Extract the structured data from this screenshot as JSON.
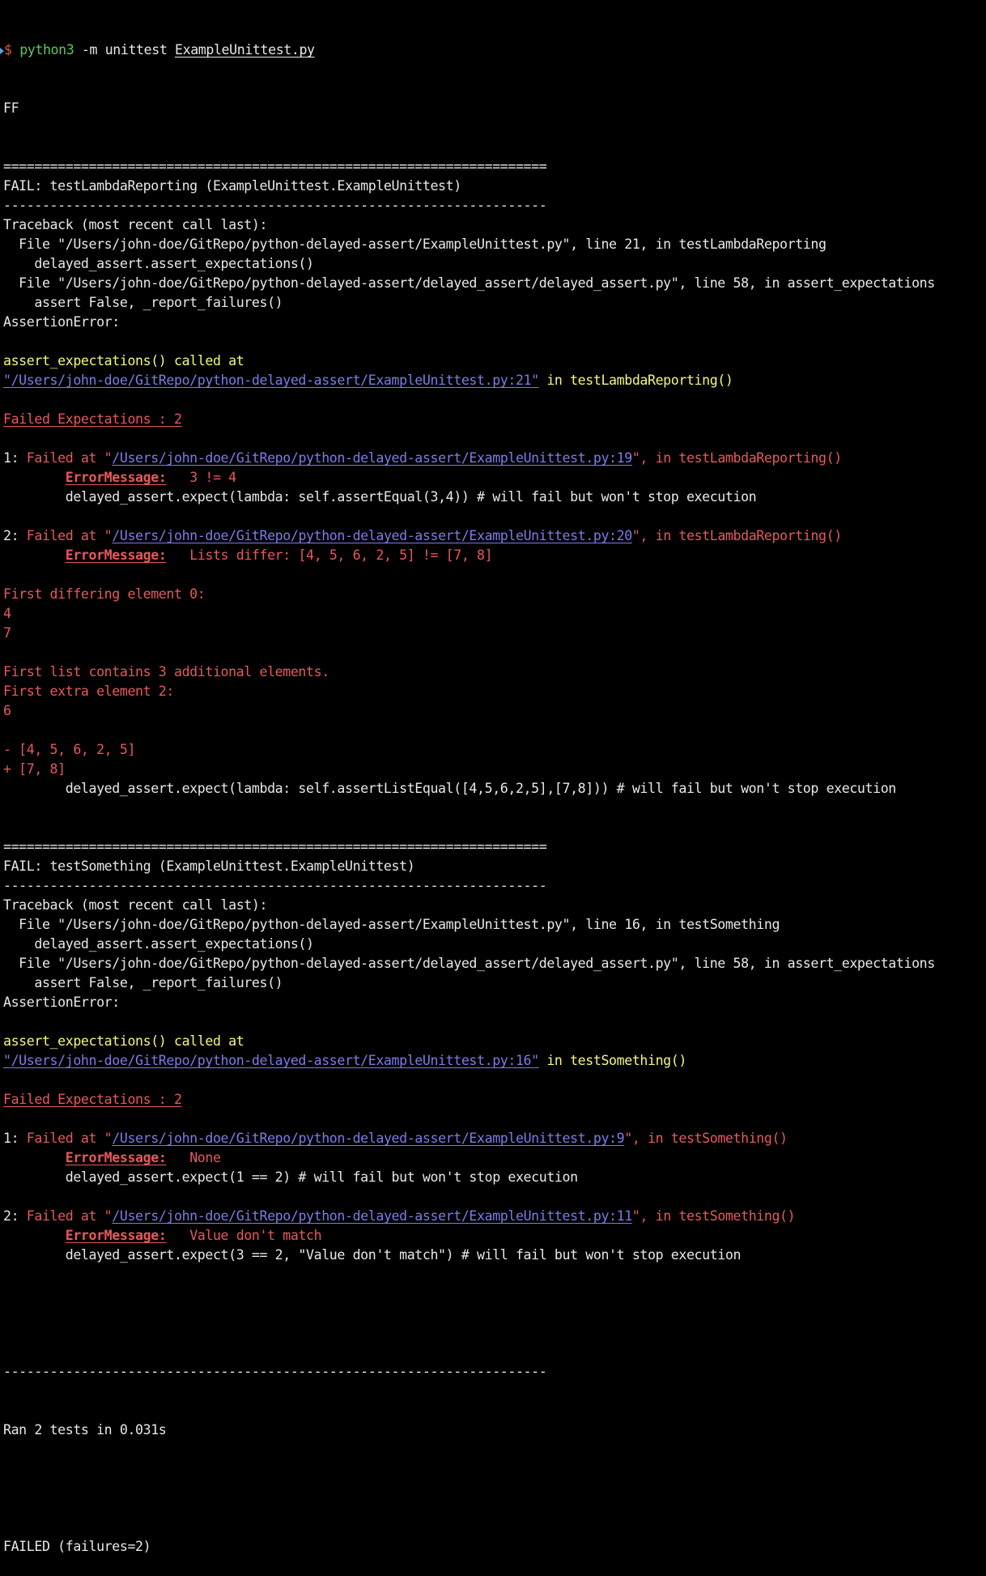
{
  "terminal": {
    "prompt_symbol": "$",
    "command_program": "python3",
    "command_args": " -m unittest ",
    "command_file": "ExampleUnittest.py",
    "progress": "FF",
    "separator_eq": "======================================================================",
    "separator_dash": "----------------------------------------------------------------------",
    "failures": [
      {
        "header": "FAIL: testLambdaReporting (ExampleUnittest.ExampleUnittest)",
        "traceback_title": "Traceback (most recent call last):",
        "frames": [
          {
            "file_line": "  File \"/Users/john-doe/GitRepo/python-delayed-assert/ExampleUnittest.py\", line 21, in testLambdaReporting",
            "code": "    delayed_assert.assert_expectations()"
          },
          {
            "file_line": "  File \"/Users/john-doe/GitRepo/python-delayed-assert/delayed_assert/delayed_assert.py\", line 58, in assert_expectations",
            "code": "    assert False, _report_failures()"
          }
        ],
        "error": "AssertionError:",
        "called_at": "assert_expectations() called at",
        "called_path": "\"/Users/john-doe/GitRepo/python-delayed-assert/ExampleUnittest.py:21\"",
        "called_in": " in testLambdaReporting()",
        "failed_count": "Failed Expectations : 2",
        "expectations": [
          {
            "prefix": "1: ",
            "failed_at": "Failed at \"",
            "path": "/Users/john-doe/GitRepo/python-delayed-assert/ExampleUnittest.py:19",
            "suffix": "\", in testLambdaReporting()",
            "error_label": "ErrorMessage:",
            "error_message": "   3 != 4",
            "extra_lines": [],
            "code": "        delayed_assert.expect(lambda: self.assertEqual(3,4)) # will fail but won't stop execution"
          },
          {
            "prefix": "2: ",
            "failed_at": "Failed at \"",
            "path": "/Users/john-doe/GitRepo/python-delayed-assert/ExampleUnittest.py:20",
            "suffix": "\", in testLambdaReporting()",
            "error_label": "ErrorMessage:",
            "error_message": "   Lists differ: [4, 5, 6, 2, 5] != [7, 8]",
            "extra_lines": [
              "",
              "First differing element 0:",
              "4",
              "7",
              "",
              "First list contains 3 additional elements.",
              "First extra element 2:",
              "6",
              "",
              "- [4, 5, 6, 2, 5]",
              "+ [7, 8]"
            ],
            "code": "        delayed_assert.expect(lambda: self.assertListEqual([4,5,6,2,5],[7,8])) # will fail but won't stop execution"
          }
        ]
      },
      {
        "header": "FAIL: testSomething (ExampleUnittest.ExampleUnittest)",
        "traceback_title": "Traceback (most recent call last):",
        "frames": [
          {
            "file_line": "  File \"/Users/john-doe/GitRepo/python-delayed-assert/ExampleUnittest.py\", line 16, in testSomething",
            "code": "    delayed_assert.assert_expectations()"
          },
          {
            "file_line": "  File \"/Users/john-doe/GitRepo/python-delayed-assert/delayed_assert/delayed_assert.py\", line 58, in assert_expectations",
            "code": "    assert False, _report_failures()"
          }
        ],
        "error": "AssertionError:",
        "called_at": "assert_expectations() called at",
        "called_path": "\"/Users/john-doe/GitRepo/python-delayed-assert/ExampleUnittest.py:16\"",
        "called_in": " in testSomething()",
        "failed_count": "Failed Expectations : 2",
        "expectations": [
          {
            "prefix": "1: ",
            "failed_at": "Failed at \"",
            "path": "/Users/john-doe/GitRepo/python-delayed-assert/ExampleUnittest.py:9",
            "suffix": "\", in testSomething()",
            "error_label": "ErrorMessage:",
            "error_message": "   None",
            "extra_lines": [],
            "code": "        delayed_assert.expect(1 == 2) # will fail but won't stop execution"
          },
          {
            "prefix": "2: ",
            "failed_at": "Failed at \"",
            "path": "/Users/john-doe/GitRepo/python-delayed-assert/ExampleUnittest.py:11",
            "suffix": "\", in testSomething()",
            "error_label": "ErrorMessage:",
            "error_message": "   Value don't match",
            "extra_lines": [],
            "code": "        delayed_assert.expect(3 == 2, \"Value don't match\") # will fail but won't stop execution"
          }
        ]
      }
    ],
    "summary": "Ran 2 tests in 0.031s",
    "result": "FAILED (failures=2)"
  }
}
